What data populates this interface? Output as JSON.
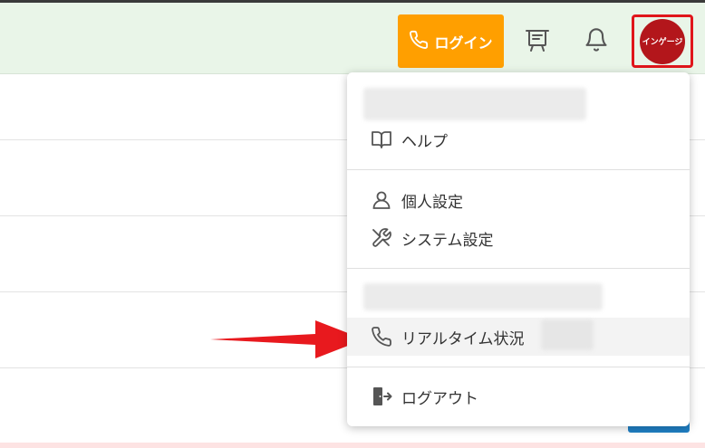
{
  "header": {
    "login_label": "ログイン",
    "avatar_text": "インゲージ"
  },
  "menu": {
    "help_label": "ヘルプ",
    "personal_settings_label": "個人設定",
    "system_settings_label": "システム設定",
    "realtime_status_label": "リアルタイム状況",
    "logout_label": "ログアウト"
  },
  "colors": {
    "accent_orange": "#ff9f00",
    "avatar_red": "#b3161b",
    "highlight_red": "#e0161b",
    "header_green": "#e9f5e8"
  },
  "icons": {
    "login": "phone-icon",
    "board": "presentation-board-icon",
    "bell": "bell-icon",
    "help": "book-icon",
    "personal": "user-icon",
    "system": "tools-icon",
    "realtime": "phone-icon",
    "logout": "exit-door-icon"
  }
}
